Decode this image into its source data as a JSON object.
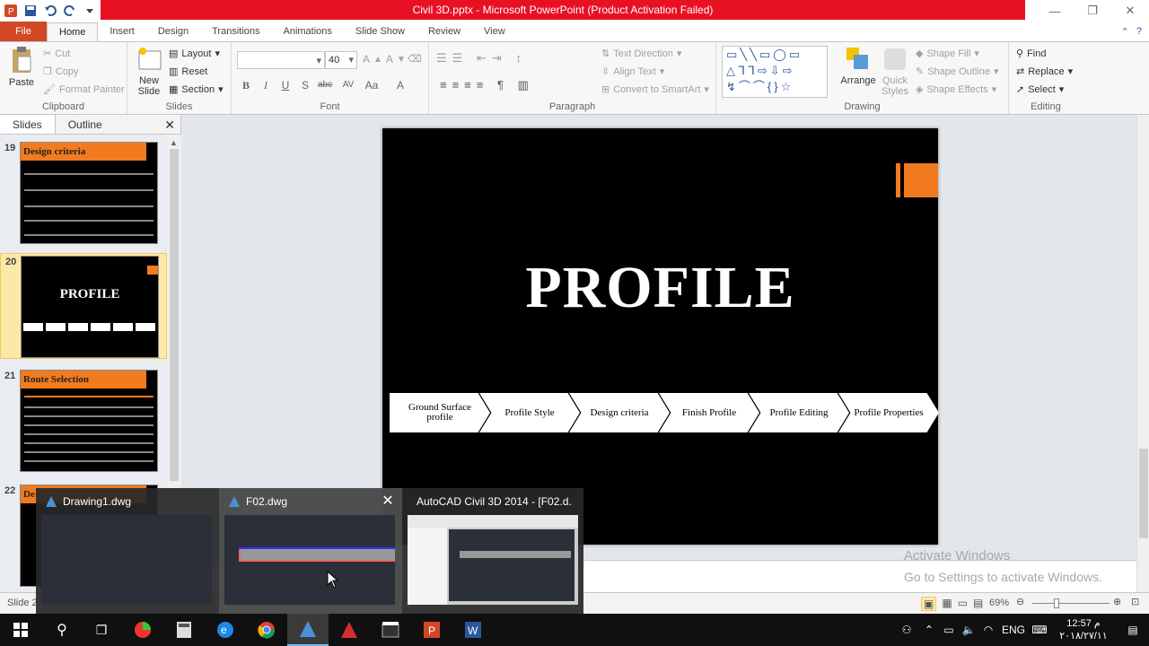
{
  "window": {
    "title": "Civil 3D.pptx - Microsoft PowerPoint (Product Activation Failed)"
  },
  "tabs": [
    "File",
    "Home",
    "Insert",
    "Design",
    "Transitions",
    "Animations",
    "Slide Show",
    "Review",
    "View"
  ],
  "ribbon": {
    "clipboard": {
      "label": "Clipboard",
      "paste": "Paste",
      "cut": "Cut",
      "copy": "Copy",
      "format_painter": "Format Painter"
    },
    "slides": {
      "label": "Slides",
      "new_slide_1": "New",
      "new_slide_2": "Slide",
      "layout": "Layout",
      "reset": "Reset",
      "section": "Section"
    },
    "font": {
      "label": "Font",
      "font_name": "",
      "font_size": "40"
    },
    "paragraph": {
      "label": "Paragraph",
      "text_direction": "Text Direction",
      "align_text": "Align Text",
      "convert_smartart": "Convert to SmartArt"
    },
    "drawing": {
      "label": "Drawing",
      "arrange": "Arrange",
      "quick_styles_1": "Quick",
      "quick_styles_2": "Styles",
      "shape_fill": "Shape Fill",
      "shape_outline": "Shape Outline",
      "shape_effects": "Shape Effects"
    },
    "editing": {
      "label": "Editing",
      "find": "Find",
      "replace": "Replace",
      "select": "Select"
    }
  },
  "panel": {
    "tab_slides": "Slides",
    "tab_outline": "Outline",
    "thumbnails": [
      {
        "num": "19",
        "heading": "Design criteria"
      },
      {
        "num": "20",
        "heading": "PROFILE"
      },
      {
        "num": "21",
        "heading": "Route Selection"
      },
      {
        "num": "22",
        "heading": "De"
      }
    ]
  },
  "slide": {
    "title": "PROFILE",
    "steps": [
      "Ground Surface profile",
      "Profile Style",
      "Design criteria",
      "Finish Profile",
      "Profile Editing",
      "Profile Properties"
    ]
  },
  "taskbar_previews": [
    {
      "title": "Drawing1.dwg"
    },
    {
      "title": "F02.dwg"
    },
    {
      "title": "AutoCAD Civil 3D 2014 - [F02.d..."
    }
  ],
  "status": {
    "slide_info": "Slide 2",
    "zoom": "69%",
    "watermark_1": "Activate Windows",
    "watermark_2": "Go to Settings to activate Windows."
  },
  "tray": {
    "lang": "ENG",
    "time": "12:57 م",
    "date": "٢٠١٨/٢٧/١١"
  },
  "colors": {
    "accent_orange": "#f27b1f",
    "title_red": "#e81123",
    "file_tab": "#d24726"
  }
}
